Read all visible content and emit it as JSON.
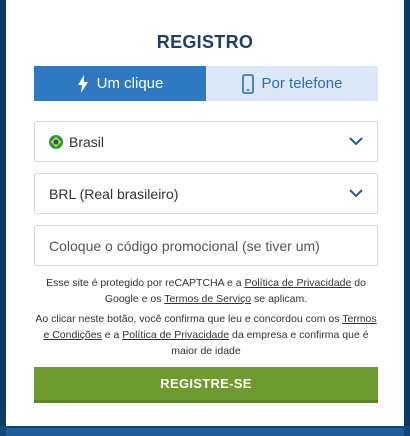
{
  "modal": {
    "title": "REGISTRO"
  },
  "tabs": [
    {
      "label": "Um clique",
      "icon": "lightning-icon",
      "active": true
    },
    {
      "label": "Por telefone",
      "icon": "phone-icon",
      "active": false
    }
  ],
  "country_select": {
    "value": "Brasil",
    "flag_icon": "brazil-flag-icon"
  },
  "currency_select": {
    "value": "BRL (Real brasileiro)"
  },
  "promo_input": {
    "placeholder": "Coloque o código promocional (se tiver um)"
  },
  "recaptcha_note": {
    "part1": "Esse site é protegido por reCAPTCHA e a ",
    "privacy_link": "Política de Privacidade",
    "part2": " do Google e os ",
    "terms_link": "Termos de Serviço",
    "part3": " se aplicam."
  },
  "consent_note": {
    "part1": "Ao clicar neste botão, você confirma que leu e concordou com os ",
    "terms_link": "Termos e Condições",
    "part2": " e a ",
    "privacy_link": "Política de Privacidade",
    "part3": " da empresa e confirma que é maior de idade"
  },
  "submit_button": {
    "label": "REGISTRE-SE"
  },
  "colors": {
    "accent_blue": "#2f79c2",
    "tab_inactive_bg": "#dce8f5",
    "cta_green": "#6f9a31",
    "title_color": "#1d3f66"
  }
}
